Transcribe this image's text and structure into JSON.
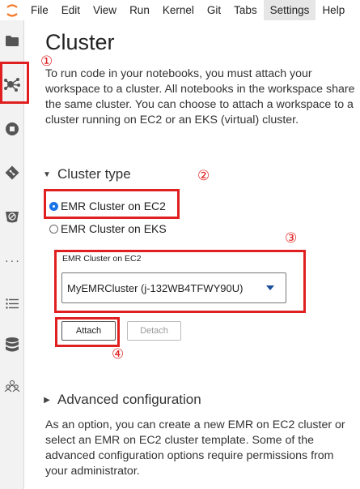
{
  "menubar": {
    "items": [
      "File",
      "Edit",
      "View",
      "Run",
      "Kernel",
      "Git",
      "Tabs",
      "Settings",
      "Help"
    ],
    "active_item": "Settings"
  },
  "sidebar": {
    "icons": [
      "folder-icon",
      "cluster-icon",
      "stop-circle-icon",
      "git-icon",
      "extension-icon",
      "code-snippets-icon",
      "table-of-contents-icon",
      "database-icon",
      "users-icon"
    ]
  },
  "cluster": {
    "title": "Cluster",
    "intro": "To run code in your notebooks, you must attach your workspace to a cluster. All notebooks in the workspace share the same cluster. You can choose to attach a workspace to a cluster running on EC2 or an EKS (virtual) cluster.",
    "cluster_type": {
      "heading": "Cluster type",
      "options": [
        {
          "label": "EMR Cluster on EC2",
          "checked": true
        },
        {
          "label": "EMR Cluster on EKS",
          "checked": false
        }
      ]
    },
    "select": {
      "label": "EMR Cluster on EC2",
      "value": "MyEMRCluster (j-132WB4TFWY90U)"
    },
    "attach_label": "Attach",
    "detach_label": "Detach",
    "advanced": {
      "heading": "Advanced configuration",
      "text": "As an option, you can create a new EMR on EC2 cluster or select an EMR on EC2 cluster template. Some of the advanced configuration options require permissions from your administrator."
    }
  },
  "annotations": [
    "①",
    "②",
    "③",
    "④"
  ],
  "colors": {
    "annotation": "#e02020",
    "radio_accent": "#1a73e8",
    "logo": "#f37626"
  }
}
